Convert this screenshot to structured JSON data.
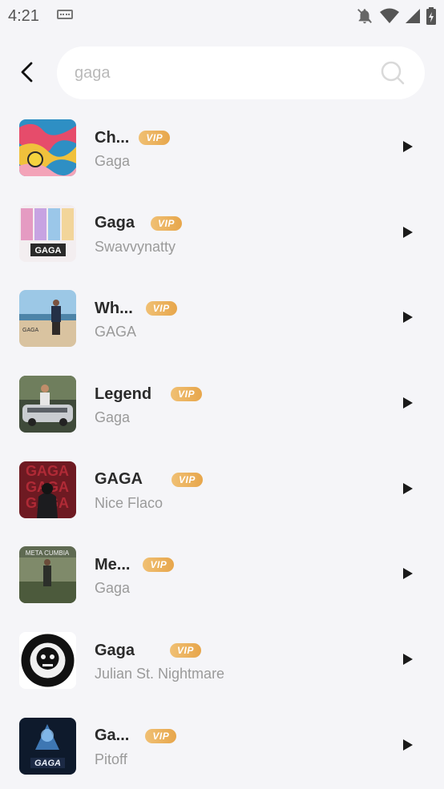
{
  "status_bar": {
    "time": "4:21"
  },
  "search": {
    "value": "gaga",
    "placeholder": ""
  },
  "colors": {
    "vip_start": "#f0c074",
    "vip_end": "#e7a64b",
    "background": "#f5f5f8"
  },
  "songs": [
    {
      "title": "Ch...",
      "artist": "Gaga",
      "badge": "VIP"
    },
    {
      "title": "Gaga",
      "artist": "Swavvynatty",
      "badge": "VIP"
    },
    {
      "title": "Wh...",
      "artist": "GAGA",
      "badge": "VIP"
    },
    {
      "title": "Legend",
      "artist": "Gaga",
      "badge": "VIP"
    },
    {
      "title": "GAGA",
      "artist": "Nice Flaco",
      "badge": "VIP"
    },
    {
      "title": "Me...",
      "artist": "Gaga",
      "badge": "VIP"
    },
    {
      "title": "Gaga",
      "artist": "Julian St. Nightmare",
      "badge": "VIP"
    },
    {
      "title": "Ga...",
      "artist": "Pitoff",
      "badge": "VIP"
    }
  ]
}
